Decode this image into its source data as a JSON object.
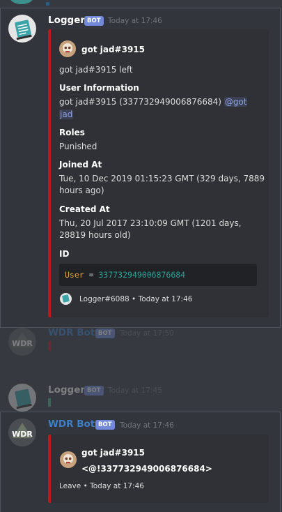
{
  "messages": {
    "first": {
      "author": "Logger",
      "bot_tag": "BOT",
      "timestamp": "Today at 17:46",
      "embed": {
        "author_name": "got jad#3915",
        "description": "got jad#3915 left",
        "user_info_name": "User Information",
        "user_info_value_pre": "got jad#3915 (337732949006876684)",
        "user_info_mention_a": "@got",
        "user_info_mention_b": "jad",
        "roles_name": "Roles",
        "roles_value": "Punished",
        "joined_name": "Joined At",
        "joined_value_1": "Tue, 10 Dec 2019 01:15:23 GMT (329 days, 7889",
        "joined_value_2": "hours ago)",
        "created_name": "Created At",
        "created_value_1": "Thu, 20 Jul 2017 23:10:09 GMT (1201 days,",
        "created_value_2": "28819 hours old)",
        "id_name": "ID",
        "code_key": "User",
        "code_eq": " = ",
        "code_value": "337732949006876684",
        "footer": "Logger#6088 • Today at 17:46",
        "accent": "#c3161c"
      }
    },
    "second": {
      "author": "WDR Bot",
      "bot_tag": "BOT",
      "timestamp": "Today at 17:50",
      "avatar_text": "WDR"
    },
    "third": {
      "author": "Logger",
      "bot_tag": "BOT",
      "timestamp": "Today at 17:45"
    },
    "fourth": {
      "author": "WDR Bot",
      "bot_tag": "BOT",
      "timestamp": "Today at 17:46",
      "avatar_text": "WDR",
      "embed": {
        "title_1": "got jad#3915",
        "title_2": "<@!337732949006876684>",
        "footer": "Leave • Today at 17:46"
      }
    }
  },
  "colors": {
    "background": "#36393f",
    "embed_bg": "#2f3136",
    "bot_tag": "#7289da",
    "embed_accent_red": "#c3161c",
    "embed_accent_green": "#43b581",
    "wdr_name": "#3e7fc8"
  }
}
